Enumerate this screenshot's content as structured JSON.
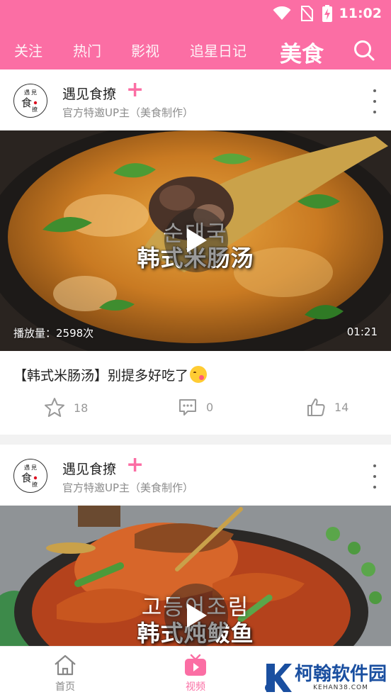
{
  "status_bar": {
    "time": "11:02"
  },
  "tabs": [
    {
      "label": "关注"
    },
    {
      "label": "热门"
    },
    {
      "label": "影视"
    },
    {
      "label": "追星日记"
    },
    {
      "label": "美食"
    }
  ],
  "colors": {
    "brand": "#fb6ea4"
  },
  "feed": [
    {
      "author": "遇见食撩",
      "follow_symbol": "+",
      "subtitle": "官方特邀UP主（美食制作）",
      "avatar_text": [
        "遇",
        "見",
        "食",
        "撩"
      ],
      "caption_ko": "순대국",
      "caption_zh": "韩式米肠汤",
      "views": "播放量：2598次",
      "duration": "01:21",
      "title": "【韩式米肠汤】别提多好吃了",
      "favorites": "18",
      "comments": "0",
      "likes": "14"
    },
    {
      "author": "遇见食撩",
      "follow_symbol": "+",
      "subtitle": "官方特邀UP主（美食制作）",
      "avatar_text": [
        "遇",
        "見",
        "食",
        "撩"
      ],
      "caption_ko": "고등어조림",
      "caption_zh": "韩式炖鲅鱼"
    }
  ],
  "bottom_nav": [
    {
      "label": "首页",
      "icon": "home-icon"
    },
    {
      "label": "视频",
      "icon": "video-icon"
    }
  ],
  "watermark": {
    "name": "柯翰软件园",
    "url": "KEHAN38.COM"
  }
}
